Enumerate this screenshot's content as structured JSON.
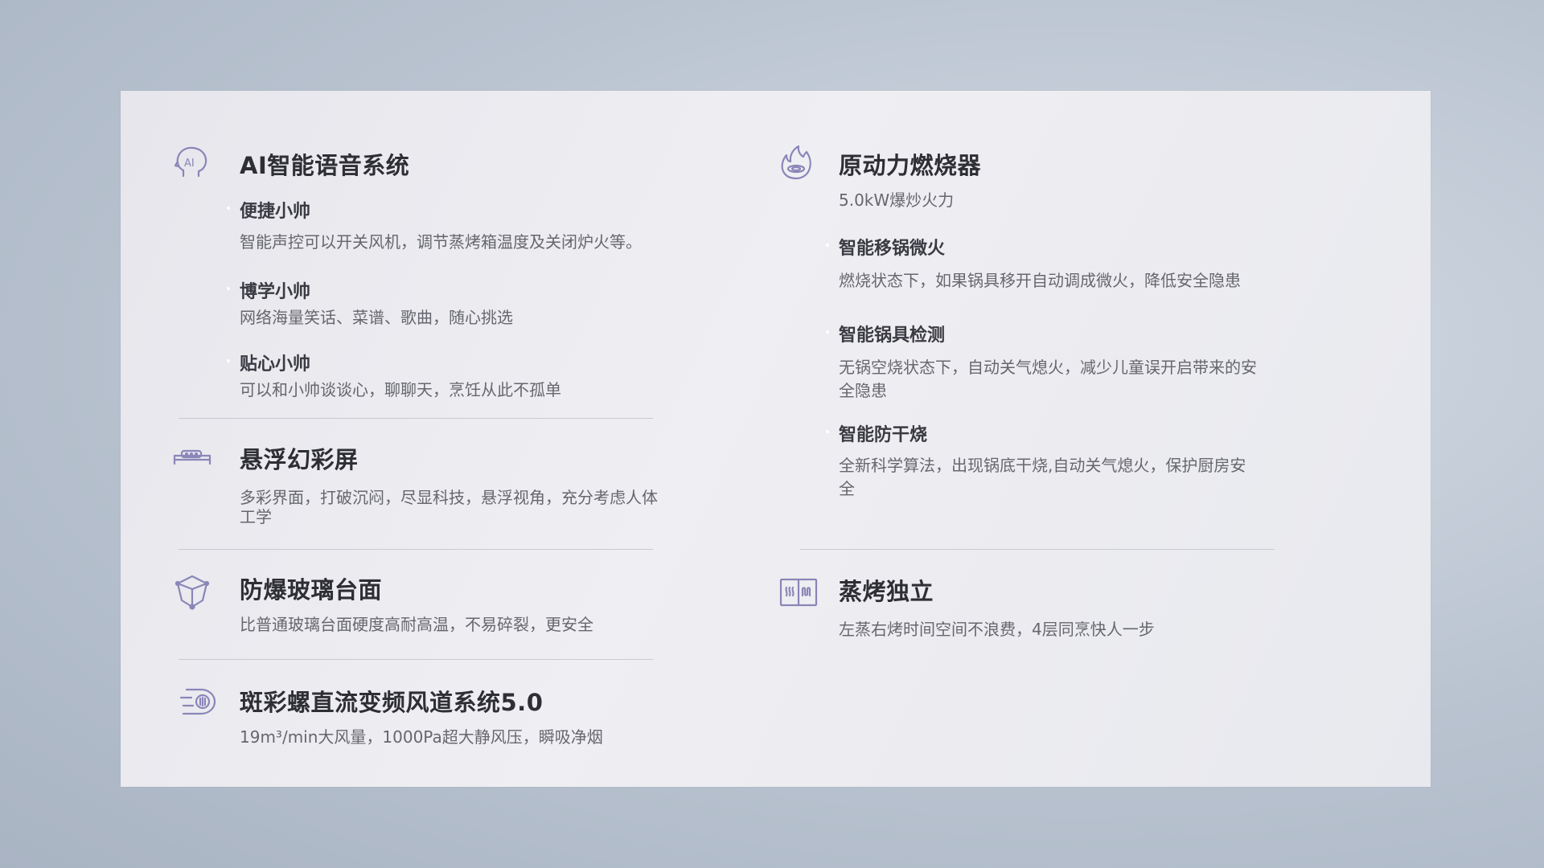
{
  "colors": {
    "icon_stroke": "#8a86b8",
    "title": "#2e2e35",
    "desc": "#66666e"
  },
  "left": {
    "voice": {
      "icon": "ai-head-icon",
      "title": "AI智能语音系统",
      "items": [
        {
          "title": "便捷小帅",
          "desc": "智能声控可以开关风机，调节蒸烤箱温度及关闭炉火等。"
        },
        {
          "title": "博学小帅",
          "desc": "网络海量笑话、菜谱、歌曲，随心挑选"
        },
        {
          "title": "贴心小帅",
          "desc": "可以和小帅谈谈心，聊聊天，烹饪从此不孤单"
        }
      ]
    },
    "screen": {
      "icon": "floating-screen-icon",
      "title": "悬浮幻彩屏",
      "desc": "多彩界面，打破沉闷，尽显科技，悬浮视角，充分考虑人体工学"
    },
    "glass": {
      "icon": "glass-shield-icon",
      "title": "防爆玻璃台面",
      "desc": "比普通玻璃台面硬度高耐高温，不易碎裂，更安全"
    },
    "airflow": {
      "icon": "airflow-fan-icon",
      "title": "斑彩螺直流变频风道系统5.0",
      "desc": "19m³/min大风量，1000Pa超大静风压，瞬吸净烟"
    }
  },
  "right": {
    "burner": {
      "icon": "flame-burner-icon",
      "title": "原动力燃烧器",
      "desc": "5.0kW爆炒火力",
      "items": [
        {
          "title": "智能移锅微火",
          "desc": "燃烧状态下，如果锅具移开自动调成微火，降低安全隐患"
        },
        {
          "title": "智能锅具检测",
          "desc": "无锅空烧状态下，自动关气熄火，减少儿童误开启带来的安全隐患"
        },
        {
          "title": "智能防干烧",
          "desc": "全新科学算法，出现锅底干烧,自动关气熄火，保护厨房安全"
        }
      ]
    },
    "steam": {
      "icon": "steam-oven-icon",
      "title": "蒸烤独立",
      "desc": "左蒸右烤时间空间不浪费，4层同烹快人一步"
    }
  }
}
